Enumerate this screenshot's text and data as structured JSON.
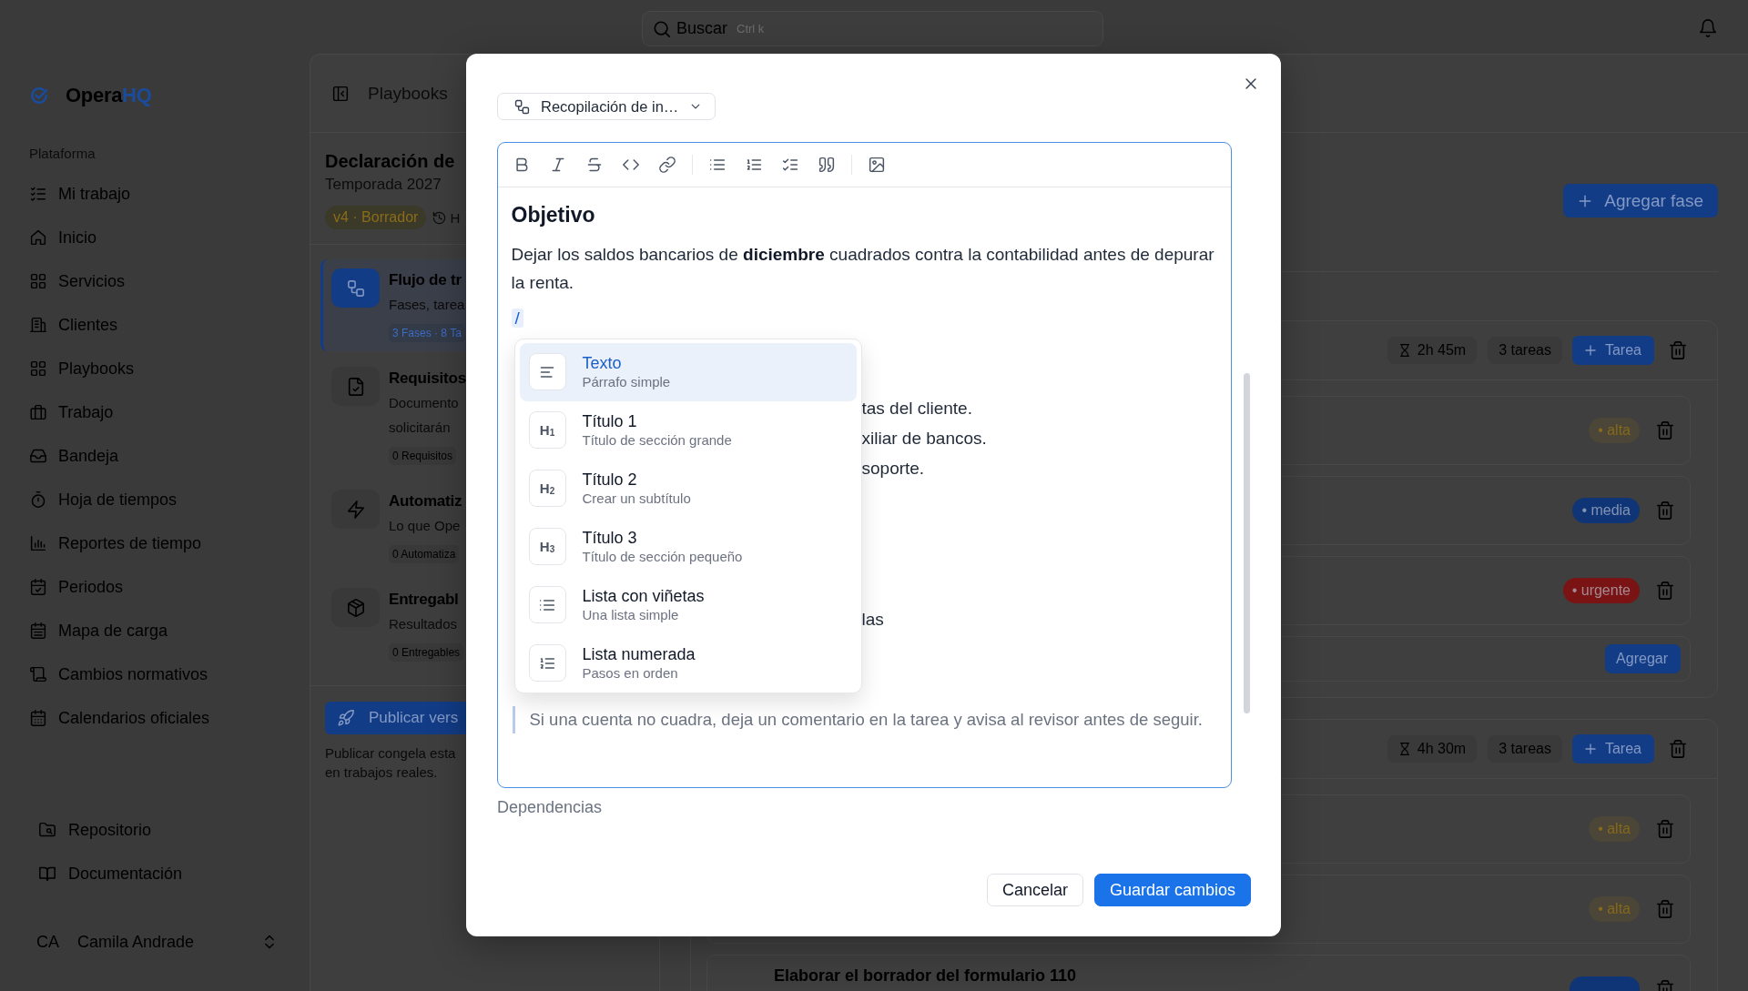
{
  "topbar": {
    "search": {
      "placeholder": "Buscar",
      "shortcut": "Ctrl k"
    }
  },
  "sidebar": {
    "brand": {
      "name": "Opera",
      "accent": "HQ"
    },
    "section_label": "Plataforma",
    "items": [
      {
        "label": "Mi trabajo",
        "selected": false
      },
      {
        "label": "Inicio",
        "selected": false
      },
      {
        "label": "Servicios",
        "selected": false
      },
      {
        "label": "Clientes",
        "selected": false
      },
      {
        "label": "Playbooks",
        "selected": false
      },
      {
        "label": "Trabajo",
        "selected": false
      },
      {
        "label": "Bandeja",
        "selected": false
      },
      {
        "label": "Hoja de tiempos",
        "selected": false
      },
      {
        "label": "Reportes de tiempo",
        "selected": false
      },
      {
        "label": "Periodos",
        "selected": false
      },
      {
        "label": "Mapa de carga",
        "selected": false
      },
      {
        "label": "Cambios normativos",
        "selected": false
      },
      {
        "label": "Calendarios oficiales",
        "selected": false
      }
    ],
    "footer_items": [
      {
        "label": "Repositorio"
      },
      {
        "label": "Documentación"
      }
    ],
    "user": {
      "initials": "CA",
      "name": "Camila Andrade"
    }
  },
  "breadcrumb": "Playbooks",
  "playbook": {
    "title": "Declaración de",
    "subtitle": "Temporada 2027",
    "version": "v4 · Borrador",
    "history": "H",
    "sections": [
      {
        "title": "Flujo de tr",
        "description": [
          "Fases, tarea"
        ],
        "count": "3 Fases · 8 Ta",
        "selected": true
      },
      {
        "title": "Requisitos",
        "description": [
          "Documento",
          "solicitarán"
        ],
        "count": "0 Requisitos",
        "selected": false
      },
      {
        "title": "Automatiz",
        "description": [
          "Lo que Ope"
        ],
        "count": "0 Automatiza",
        "selected": false
      },
      {
        "title": "Entregabl",
        "description": [
          "Resultados"
        ],
        "count": "0 Entregables",
        "selected": false
      }
    ],
    "publish": {
      "label": "Publicar vers",
      "note": [
        "Publicar congela esta",
        "en trabajos reales."
      ]
    }
  },
  "board": {
    "add_phase": "Agregar fase",
    "phases": [
      {
        "duration": "2h 45m",
        "task_count": "3 tareas",
        "add_task": "Tarea",
        "tasks": [
          {
            "priority": "• alta",
            "kind": "soft",
            "color": "#86691a"
          },
          {
            "priority": "• media",
            "kind": "solid",
            "color": "#0f3577"
          },
          {
            "priority": "• urgente",
            "kind": "solid",
            "color": "#7a1414"
          }
        ],
        "new_task_button": "Agregar"
      },
      {
        "duration": "4h 30m",
        "task_count": "3 tareas",
        "add_task": "Tarea",
        "tasks": [
          {
            "priority": "• alta",
            "kind": "soft",
            "color": "#86691a"
          },
          {
            "priority": "• alta",
            "kind": "soft",
            "color": "#86691a"
          },
          {
            "title": "Elaborar el borrador del formulario 110",
            "kind": "solid",
            "color": "#0f3577"
          }
        ]
      }
    ]
  },
  "modal": {
    "phase_select": {
      "value": "Recopilación de in…"
    },
    "editor": {
      "heading": "Objetivo",
      "paragraph": "Dejar los saldos bancarios de **diciembre** cuadrados contra la contabilidad antes de depurar la renta.",
      "command": "/",
      "covered_lists": [
        {
          "items": [
            "tas del cliente.",
            "xiliar de bancos.",
            "soporte."
          ]
        },
        {
          "items": [
            "las"
          ]
        }
      ],
      "quote": "Si una cuenta no cuadra, deja un comentario en la tarea y avisa al revisor antes de seguir.",
      "slash_menu": [
        {
          "kind": "text",
          "title": "Texto",
          "subtitle": "Párrafo simple",
          "selected": true
        },
        {
          "kind": "heading",
          "glyph": "H$_{1}$",
          "title": "Título 1",
          "subtitle": "Título de sección grande",
          "selected": false
        },
        {
          "kind": "heading",
          "glyph": "H$_{2}$",
          "title": "Título 2",
          "subtitle": "Crear un subtítulo",
          "selected": false
        },
        {
          "kind": "heading",
          "glyph": "H$_{3}$",
          "title": "Título 3",
          "subtitle": "Título de sección pequeño",
          "selected": false
        },
        {
          "kind": "bullets",
          "title": "Lista con viñetas",
          "subtitle": "Una lista simple",
          "selected": false
        },
        {
          "kind": "numbers",
          "title": "Lista numerada",
          "subtitle": "Pasos en orden",
          "selected": false
        }
      ]
    },
    "dependencies_label": "Dependencias",
    "buttons": [
      {
        "label": "Cancelar",
        "kind": "secondary"
      },
      {
        "label": "Guardar cambios",
        "kind": "primary"
      }
    ]
  }
}
